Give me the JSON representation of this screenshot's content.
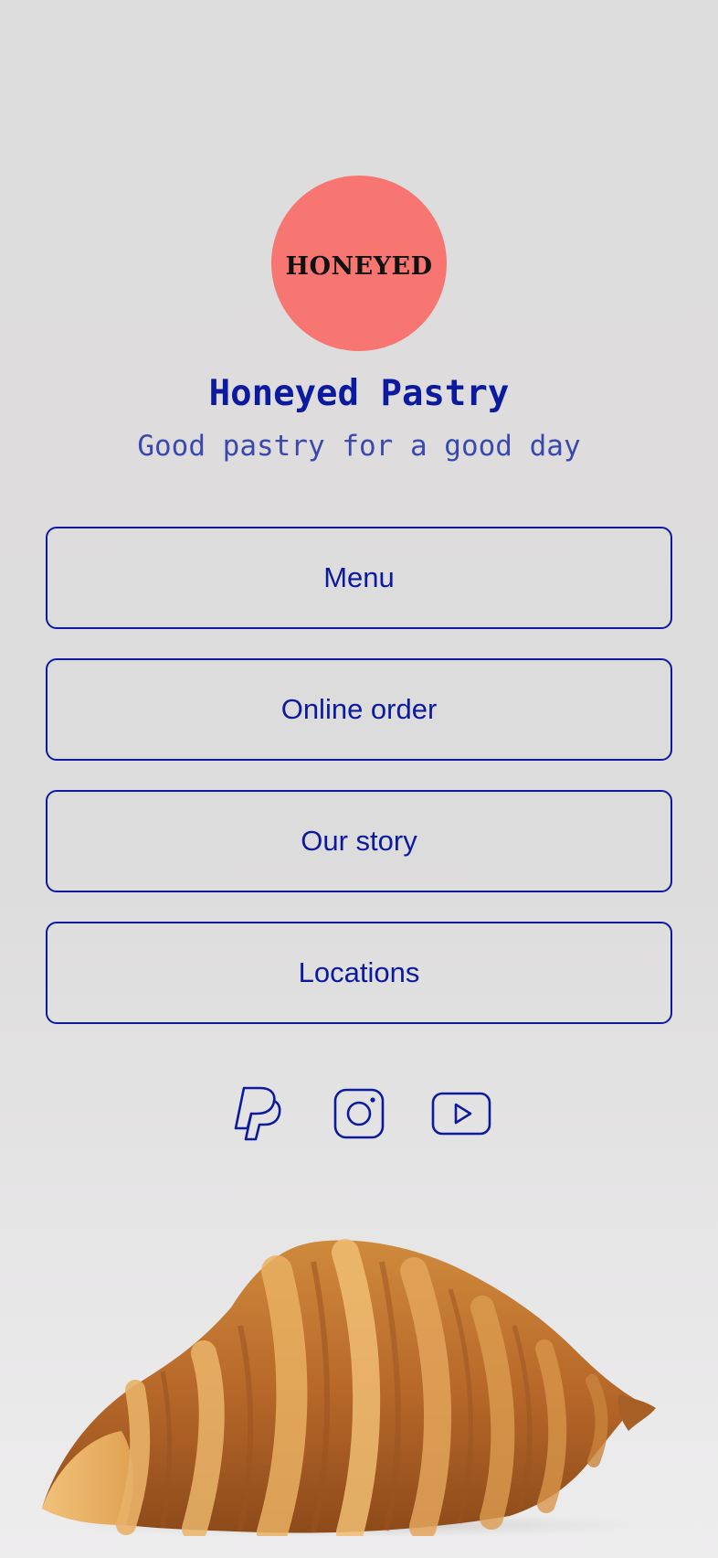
{
  "logo": {
    "text": "HONEYED",
    "bg_color": "#f87671"
  },
  "profile": {
    "title": "Honeyed Pastry",
    "subtitle": "Good pastry for a good day"
  },
  "links": [
    {
      "label": "Menu"
    },
    {
      "label": "Online order"
    },
    {
      "label": "Our story"
    },
    {
      "label": "Locations"
    }
  ],
  "socials": [
    {
      "icon": "paypal-icon"
    },
    {
      "icon": "instagram-icon"
    },
    {
      "icon": "youtube-icon"
    }
  ],
  "colors": {
    "accent": "#0b1a9e",
    "subtitle": "#3a49ad",
    "background": "#dedddd"
  }
}
